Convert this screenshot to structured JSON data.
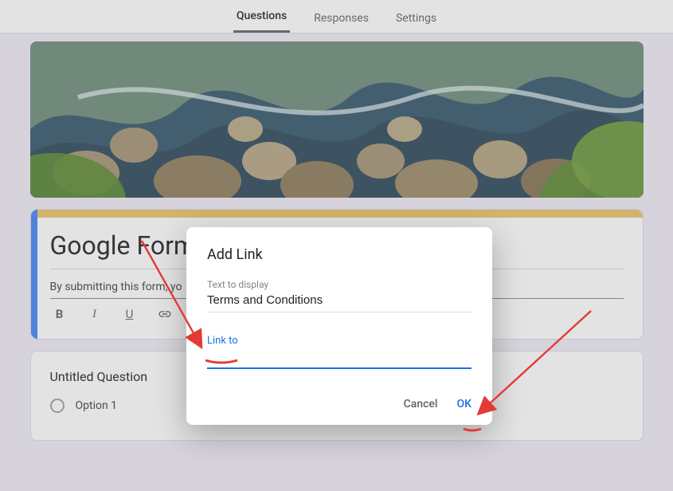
{
  "tabs": {
    "questions": "Questions",
    "responses": "Responses",
    "settings": "Settings"
  },
  "form": {
    "title": "Google Form – Terms and Conditions",
    "description_visible": "By submitting this form, yo"
  },
  "question": {
    "title": "Untitled Question",
    "option1": "Option 1"
  },
  "dialog": {
    "title": "Add Link",
    "text_label": "Text to display",
    "text_value": "Terms and Conditions",
    "link_label": "Link to",
    "link_value": "",
    "cancel": "Cancel",
    "ok": "OK"
  }
}
